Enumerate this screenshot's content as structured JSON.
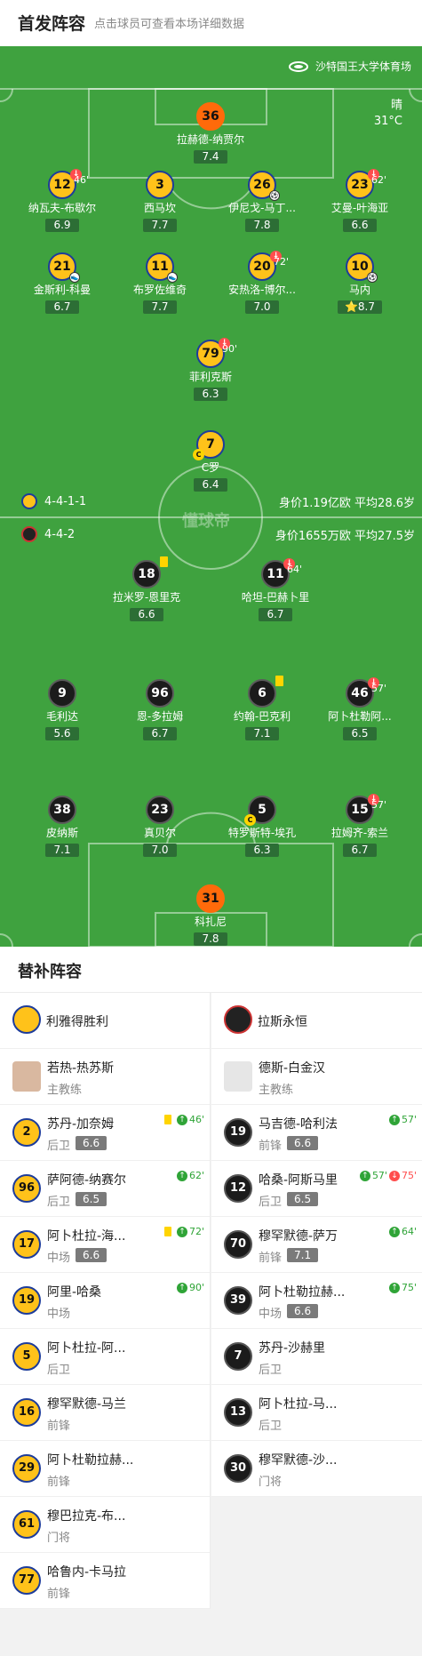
{
  "header": {
    "title": "首发阵容",
    "subtitle": "点击球员可查看本场详细数据"
  },
  "pitch": {
    "stadium": "沙特国王大学体育场",
    "weather": "晴",
    "temperature": "31°C",
    "watermark": "懂球帝"
  },
  "home_formation": "4-4-1-1",
  "away_formation": "4-4-2",
  "home_info": "身价1.19亿欧  平均28.6岁",
  "away_info": "身价1655万欧  平均27.5岁",
  "home_players": [
    {
      "num": "36",
      "name": "拉赫德-纳贾尔",
      "rating": "7.4",
      "gk": true
    },
    {
      "num": "12",
      "name": "纳瓦夫-布歇尔",
      "rating": "6.9",
      "sub_min": "46'"
    },
    {
      "num": "3",
      "name": "西马坎",
      "rating": "7.7"
    },
    {
      "num": "26",
      "name": "伊尼戈-马丁...",
      "rating": "7.8",
      "ball": true
    },
    {
      "num": "23",
      "name": "艾曼-叶海亚",
      "rating": "6.6",
      "sub_min": "62'"
    },
    {
      "num": "21",
      "name": "金斯利-科曼",
      "rating": "6.7",
      "assist": true
    },
    {
      "num": "11",
      "name": "布罗佐维奇",
      "rating": "7.7",
      "assist": true
    },
    {
      "num": "20",
      "name": "安热洛-博尔...",
      "rating": "7.0",
      "sub_min": "72'"
    },
    {
      "num": "10",
      "name": "马内",
      "rating": "8.7",
      "ball": true,
      "star": true
    },
    {
      "num": "79",
      "name": "菲利克斯",
      "rating": "6.3",
      "sub_min": "90'"
    },
    {
      "num": "7",
      "name": "C罗",
      "rating": "6.4",
      "captain": true
    }
  ],
  "away_players": [
    {
      "num": "18",
      "name": "拉米罗-恩里克",
      "rating": "6.6",
      "card": true
    },
    {
      "num": "11",
      "name": "哈坦-巴赫卜里",
      "rating": "6.7",
      "sub_min": "64'"
    },
    {
      "num": "9",
      "name": "毛利达",
      "rating": "5.6"
    },
    {
      "num": "96",
      "name": "恩-多拉姆",
      "rating": "6.7"
    },
    {
      "num": "6",
      "name": "约翰-巴克利",
      "rating": "7.1",
      "card": true
    },
    {
      "num": "46",
      "name": "阿卜杜勒阿...",
      "rating": "6.5",
      "sub_min": "57'"
    },
    {
      "num": "38",
      "name": "皮纳斯",
      "rating": "7.1"
    },
    {
      "num": "23",
      "name": "真贝尔",
      "rating": "7.0"
    },
    {
      "num": "5",
      "name": "特罗斯特-埃孔",
      "rating": "6.3",
      "captain": true
    },
    {
      "num": "15",
      "name": "拉姆齐-索兰",
      "rating": "6.7",
      "sub_min": "57'"
    },
    {
      "num": "31",
      "name": "科扎尼",
      "rating": "7.8",
      "gk": true
    }
  ],
  "subs": {
    "title": "替补阵容",
    "home_team": "利雅得胜利",
    "away_team": "拉斯永恒",
    "home_coach": {
      "name": "若热-热苏斯",
      "role": "主教练"
    },
    "away_coach": {
      "name": "德斯-白金汉",
      "role": "主教练"
    },
    "home": [
      {
        "num": "2",
        "name": "苏丹-加奈姆",
        "pos": "后卫",
        "rating": "6.6",
        "card": true,
        "in": "46'"
      },
      {
        "num": "96",
        "name": "萨阿德-纳赛尔",
        "pos": "后卫",
        "rating": "6.5",
        "in": "62'"
      },
      {
        "num": "17",
        "name": "阿卜杜拉-海...",
        "pos": "中场",
        "rating": "6.6",
        "card": true,
        "in": "72'"
      },
      {
        "num": "19",
        "name": "阿里-哈桑",
        "pos": "中场",
        "in": "90'"
      },
      {
        "num": "5",
        "name": "阿卜杜拉-阿...",
        "pos": "后卫"
      },
      {
        "num": "16",
        "name": "穆罕默德-马兰",
        "pos": "前锋"
      },
      {
        "num": "29",
        "name": "阿卜杜勒拉赫...",
        "pos": "前锋"
      },
      {
        "num": "61",
        "name": "穆巴拉克-布...",
        "pos": "门将"
      },
      {
        "num": "77",
        "name": "哈鲁内-卡马拉",
        "pos": "前锋"
      }
    ],
    "away": [
      {
        "num": "19",
        "name": "马吉德-哈利法",
        "pos": "前锋",
        "rating": "6.6",
        "in": "57'"
      },
      {
        "num": "12",
        "name": "哈桑-阿斯马里",
        "pos": "后卫",
        "rating": "6.5",
        "in": "57'",
        "out": "75'"
      },
      {
        "num": "70",
        "name": "穆罕默德-萨万",
        "pos": "前锋",
        "rating": "7.1",
        "in": "64'"
      },
      {
        "num": "39",
        "name": "阿卜杜勒拉赫...",
        "pos": "中场",
        "rating": "6.6",
        "in": "75'"
      },
      {
        "num": "7",
        "name": "苏丹-沙赫里",
        "pos": "后卫"
      },
      {
        "num": "13",
        "name": "阿卜杜拉-马...",
        "pos": "后卫"
      },
      {
        "num": "30",
        "name": "穆罕默德-沙...",
        "pos": "门将"
      }
    ]
  },
  "colors": {
    "pitch": "#3fa23f",
    "home": "#ffc21a",
    "away": "#1b1b1b",
    "gk": "#ff6a0a",
    "sub_in": "#2fa437",
    "sub_out": "#ff4d4d"
  }
}
